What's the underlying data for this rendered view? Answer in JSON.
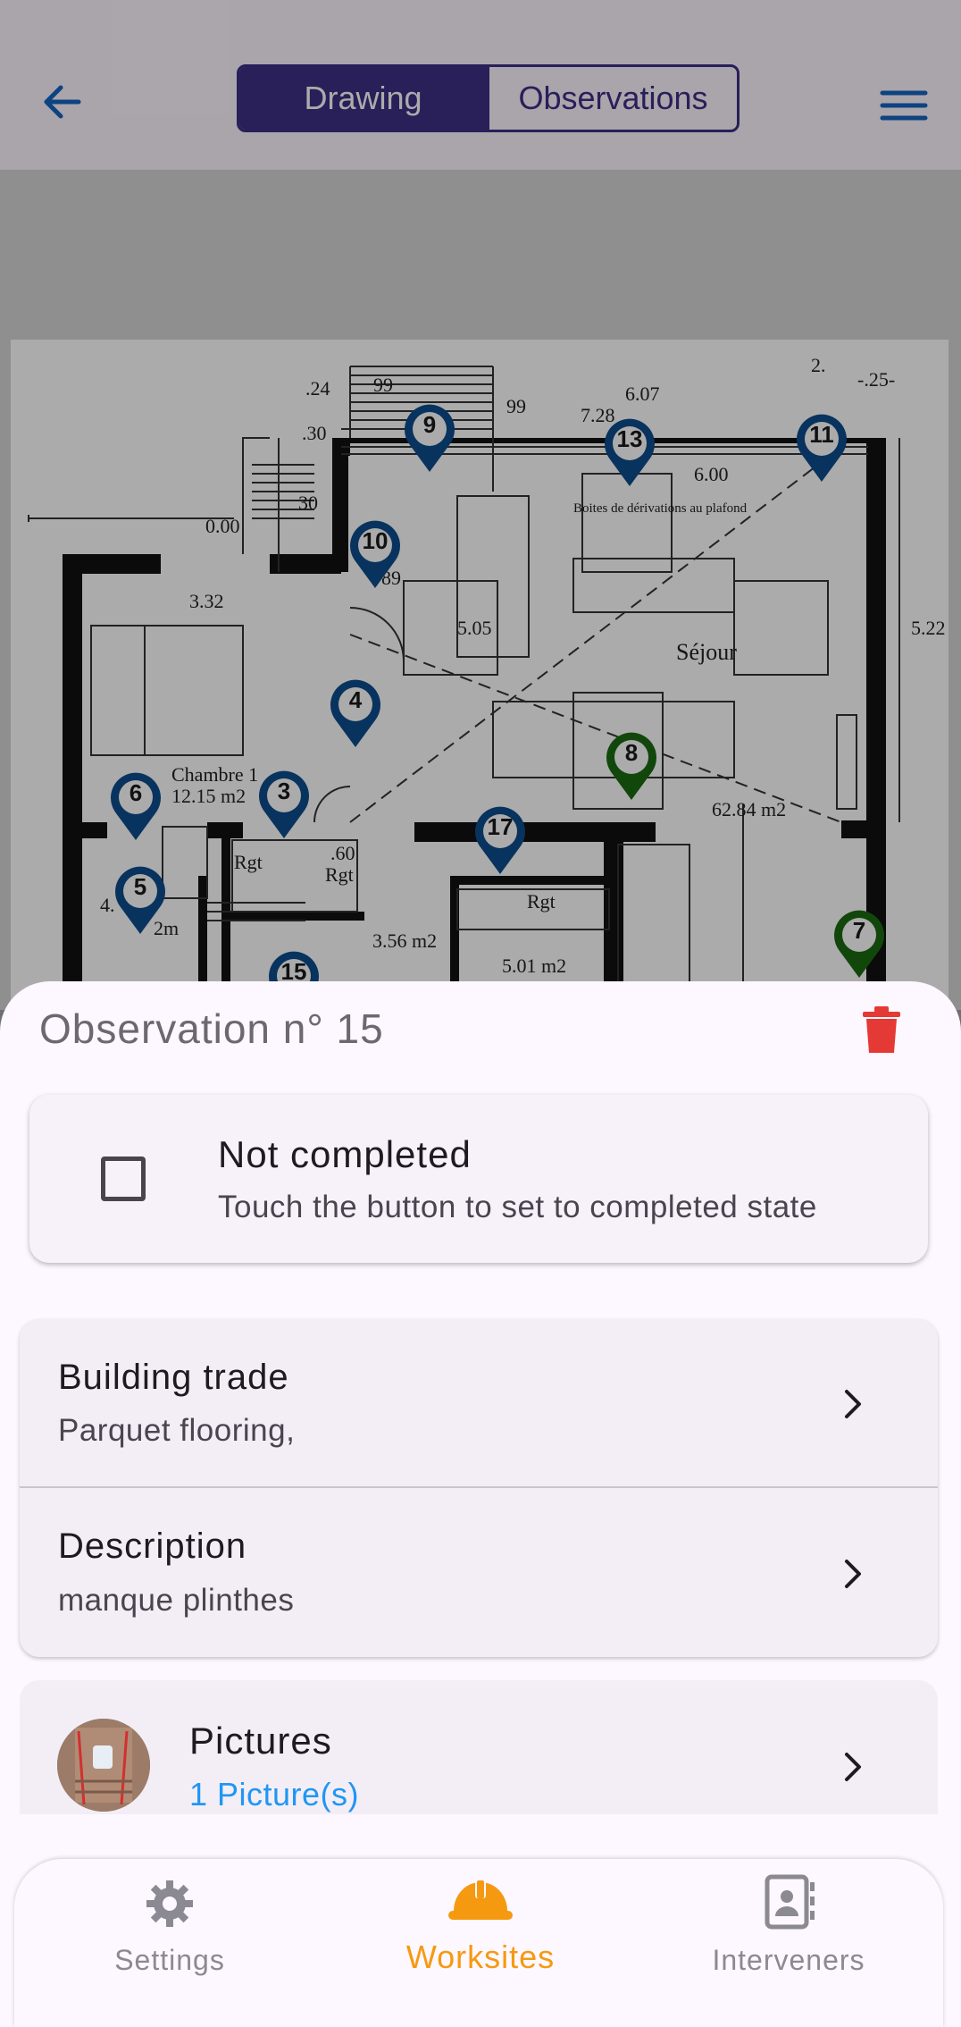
{
  "header": {
    "tabs": [
      {
        "label": "Drawing",
        "active": true
      },
      {
        "label": "Observations",
        "active": false
      }
    ],
    "back_icon": "arrow-left-icon",
    "menu_icon": "hamburger-menu-icon",
    "accent_color": "#3e2f85"
  },
  "plan": {
    "labels": {
      "room1": "Chambre 1",
      "room1_area": "12.15 m2",
      "sejour": "Séjour",
      "sejour_area": "62.84 m2",
      "ceiling_note": "Boites de dérivations au plafond",
      "area_356": "3.56 m2",
      "area_501": "5.01 m2",
      "rgt1": "Rgt",
      "rgt2": "Rgt",
      "rgt3": "Rgt",
      "dim_332": "3.32",
      "dim_600": "6.00",
      "dim_607": "6.07",
      "dim_728": "7.28",
      "dim_522": "5.22",
      "dim_505": "5.05",
      "dim_000": "0.00",
      "dim_024": ".24",
      "dim_030": ".30",
      "dim_99a": "99",
      "dim_99b": "99",
      "dim_60": ".60",
      "dim_25": "-.25-",
      "dim_2": "2.",
      "dim_30b": "30",
      "dim_89": "89",
      "dim_4": "4.",
      "dim_2m": "2m"
    },
    "pins": [
      {
        "number": "9",
        "color": "#0d4d8c"
      },
      {
        "number": "13",
        "color": "#0d4d8c"
      },
      {
        "number": "11",
        "color": "#0d4d8c"
      },
      {
        "number": "10",
        "color": "#0d4d8c"
      },
      {
        "number": "4",
        "color": "#0d4d8c"
      },
      {
        "number": "8",
        "color": "#1b6b12"
      },
      {
        "number": "6",
        "color": "#0d4d8c"
      },
      {
        "number": "3",
        "color": "#0d4d8c"
      },
      {
        "number": "17",
        "color": "#0d4d8c"
      },
      {
        "number": "5",
        "color": "#0d4d8c"
      },
      {
        "number": "7",
        "color": "#1b6b12"
      },
      {
        "number": "15",
        "color": "#0d4d8c"
      }
    ]
  },
  "sheet": {
    "title": "Observation n° 15",
    "delete_icon": "trash-icon",
    "delete_color": "#e53935",
    "status": {
      "title": "Not completed",
      "subtitle": "Touch the button to set to completed state",
      "checked": false
    },
    "building_trade": {
      "title": "Building trade",
      "value": "Parquet flooring,"
    },
    "description": {
      "title": "Description",
      "value": "manque plinthes"
    },
    "pictures": {
      "title": "Pictures",
      "value": "1 Picture(s)",
      "link_color": "#2196f3"
    }
  },
  "bottom_nav": {
    "items": [
      {
        "label": "Settings",
        "icon": "gear-icon",
        "active": false
      },
      {
        "label": "Worksites",
        "icon": "hard-hat-icon",
        "active": true
      },
      {
        "label": "Interveners",
        "icon": "contact-book-icon",
        "active": false
      }
    ],
    "active_color": "#f59a10"
  }
}
